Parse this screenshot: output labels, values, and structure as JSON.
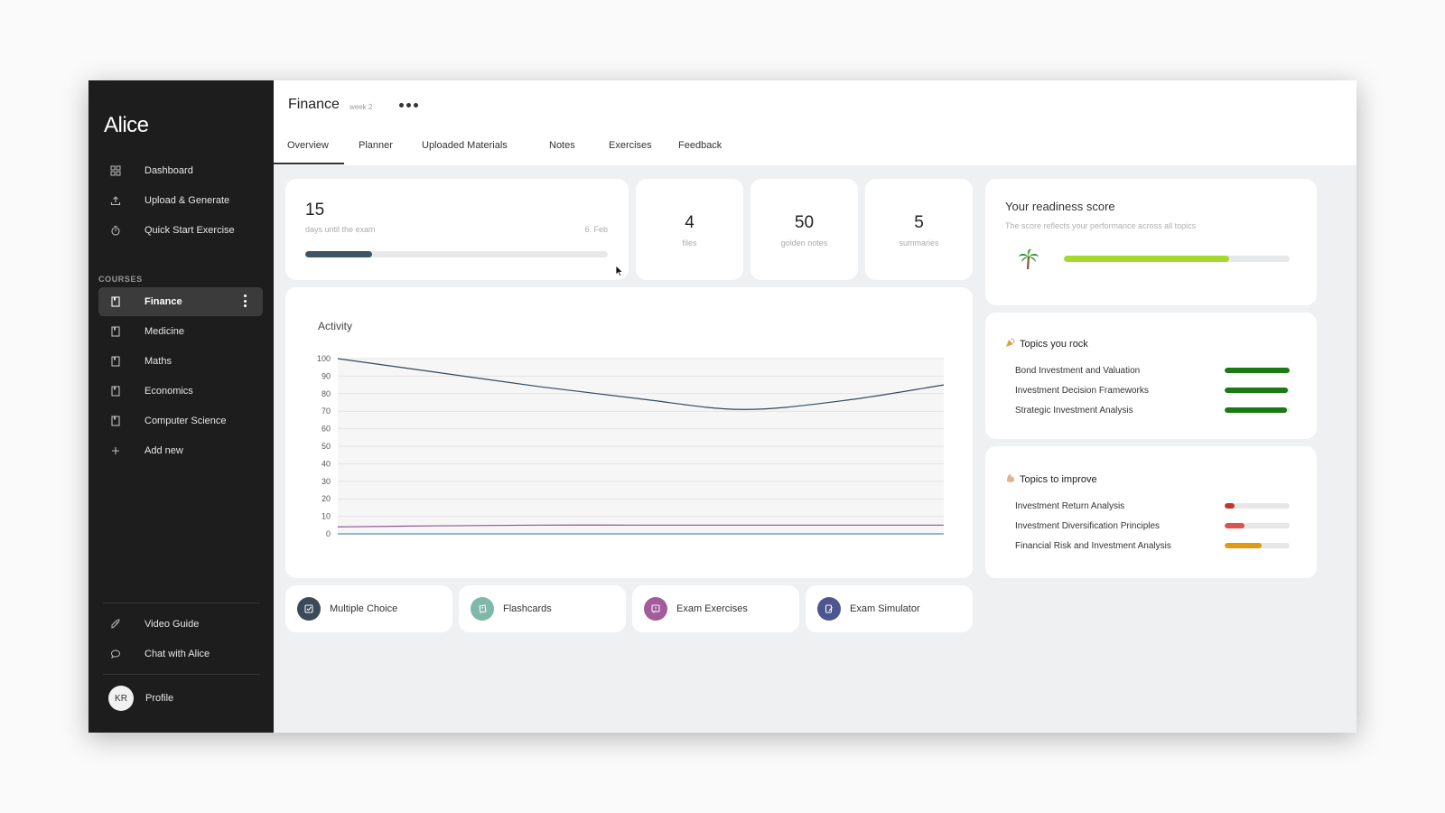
{
  "app": {
    "name": "Alice"
  },
  "sidebar": {
    "main_items": [
      {
        "label": "Dashboard",
        "icon": "grid-icon"
      },
      {
        "label": "Upload & Generate",
        "icon": "upload-icon"
      },
      {
        "label": "Quick Start Exercise",
        "icon": "timer-icon"
      }
    ],
    "courses_label": "COURSES",
    "courses": [
      {
        "label": "Finance",
        "active": true
      },
      {
        "label": "Medicine"
      },
      {
        "label": "Maths"
      },
      {
        "label": "Economics"
      },
      {
        "label": "Computer Science"
      }
    ],
    "add_new": "Add new",
    "bottom_items": [
      {
        "label": "Video Guide",
        "icon": "rocket-icon"
      },
      {
        "label": "Chat with Alice",
        "icon": "chat-bubble-icon"
      }
    ],
    "profile": {
      "initials": "KR",
      "label": "Profile"
    }
  },
  "header": {
    "title": "Finance",
    "week": "week 2",
    "tabs": [
      "Overview",
      "Planner",
      "Uploaded Materials",
      "Notes",
      "Exercises",
      "Feedback"
    ],
    "active_tab": "Overview"
  },
  "countdown": {
    "days": "15",
    "caption": "days until the exam",
    "date": "6. Feb",
    "progress": 0.22
  },
  "stats": [
    {
      "value": "4",
      "label": "files"
    },
    {
      "value": "50",
      "label": "golden notes"
    },
    {
      "value": "5",
      "label": "summaries"
    }
  ],
  "readiness": {
    "title": "Your readiness score",
    "subtitle": "The score reflects your performance across all topics",
    "icon": "palm-tree-icon",
    "value": 0.73,
    "color": "#a6d92d"
  },
  "topics_rock": {
    "title": "Topics you rock",
    "icon": "party-popper-icon",
    "items": [
      {
        "label": "Bond Investment and Valuation",
        "value": 1.0,
        "color": "#1a7a14"
      },
      {
        "label": "Investment Decision Frameworks",
        "value": 0.97,
        "color": "#1a7a14"
      },
      {
        "label": "Strategic Investment Analysis",
        "value": 0.96,
        "color": "#1a7a14"
      }
    ]
  },
  "topics_improve": {
    "title": "Topics to improve",
    "icon": "flexed-biceps-icon",
    "items": [
      {
        "label": "Investment Return Analysis",
        "value": 0.15,
        "color": "#c0392b"
      },
      {
        "label": "Investment Diversification Principles",
        "value": 0.31,
        "color": "#d9534f"
      },
      {
        "label": "Financial Risk and Investment Analysis",
        "value": 0.57,
        "color": "#e09a12"
      }
    ]
  },
  "actions": [
    {
      "label": "Multiple Choice",
      "icon": "checklist-icon",
      "color": "#3b4a5a"
    },
    {
      "label": "Flashcards",
      "icon": "flashcard-icon",
      "color": "#7fb8a8"
    },
    {
      "label": "Exam Exercises",
      "icon": "question-bubble-icon",
      "color": "#a35b9a"
    },
    {
      "label": "Exam Simulator",
      "icon": "edit-doc-icon",
      "color": "#4e5690"
    }
  ],
  "chart_data": {
    "type": "line",
    "title": "Activity",
    "ylim": [
      0,
      100
    ],
    "yticks": [
      0,
      10,
      20,
      30,
      40,
      50,
      60,
      70,
      80,
      90,
      100
    ],
    "grid": true,
    "x": [
      0,
      1,
      2,
      3,
      4,
      5,
      6
    ],
    "series": [
      {
        "values": [
          100,
          92,
          84,
          77,
          71,
          76,
          85
        ],
        "color": "#33495c"
      },
      {
        "values": [
          4,
          4.6,
          5,
          5,
          5,
          5,
          5
        ],
        "color": "#8a5a8e"
      },
      {
        "values": [
          0,
          0,
          0,
          0,
          0,
          0,
          0
        ],
        "color": "#5b8fb0"
      }
    ]
  }
}
